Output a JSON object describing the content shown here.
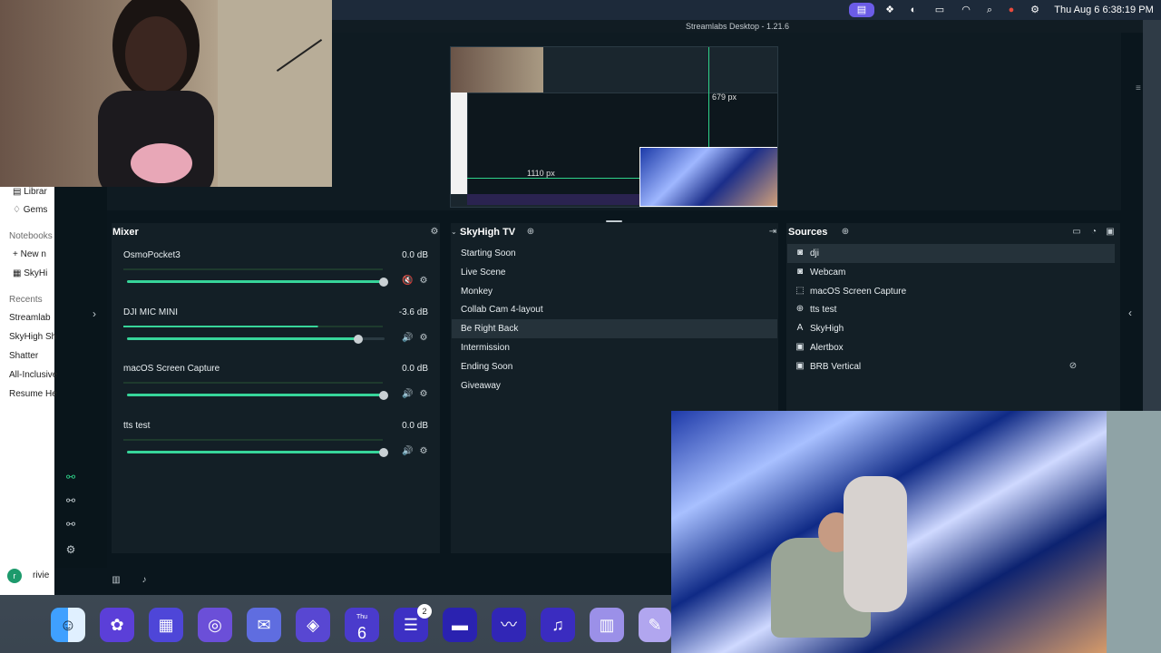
{
  "menubar": {
    "date_time": "Thu Aug 6  6:38:19 PM",
    "icons": [
      "stage-manager-icon",
      "app-icon",
      "circle-icon",
      "battery-icon",
      "wifi-icon",
      "search-icon",
      "chrome-icon",
      "control-center-icon",
      "siri-icon"
    ]
  },
  "window": {
    "title": "Streamlabs Desktop - 1.21.6"
  },
  "notebook_panel": {
    "items_top": [
      {
        "icon": "library-icon",
        "label": "Librar"
      },
      {
        "icon": "gems-icon",
        "label": "Gems"
      }
    ],
    "notebooks_label": "Notebooks",
    "notebook_items": [
      {
        "icon": "plus-icon",
        "label": "New n"
      },
      {
        "icon": "notebook-icon",
        "label": "SkyHi"
      }
    ],
    "recents_label": "Recents",
    "recents": [
      "Streamlab",
      "SkyHigh Sh",
      "Shatter",
      "All-Inclusive",
      "Resume He"
    ],
    "user_label": "rivie"
  },
  "preview": {
    "width_label": "1110 px",
    "height_label": "679 px"
  },
  "mixer": {
    "title": "Mixer",
    "items": [
      {
        "name": "OsmoPocket3",
        "db": "0.0 dB",
        "level": 1.0,
        "muted": true
      },
      {
        "name": "DJI MIC MINI",
        "db": "-3.6 dB",
        "level": 0.9,
        "muted": false
      },
      {
        "name": "macOS Screen Capture",
        "db": "0.0 dB",
        "level": 1.0,
        "muted": false
      },
      {
        "name": "tts test",
        "db": "0.0 dB",
        "level": 1.0,
        "muted": false
      }
    ]
  },
  "scenes": {
    "title": "SkyHigh TV",
    "items": [
      "Starting Soon",
      "Live Scene",
      "Monkey",
      "Collab Cam 4-layout",
      "Be Right Back",
      "Intermission",
      "Ending Soon",
      "Giveaway"
    ],
    "selected": "Be Right Back"
  },
  "sources": {
    "title": "Sources",
    "items": [
      {
        "icon": "camera-icon",
        "label": "dji"
      },
      {
        "icon": "camera-icon",
        "label": "Webcam"
      },
      {
        "icon": "screen-capture-icon",
        "label": "macOS Screen Capture"
      },
      {
        "icon": "globe-icon",
        "label": "tts test"
      },
      {
        "icon": "text-icon",
        "label": "SkyHigh"
      },
      {
        "icon": "image-icon",
        "label": "Alertbox"
      },
      {
        "icon": "image-icon",
        "label": "BRB Vertical"
      }
    ],
    "selected": "dji"
  },
  "dock": {
    "calendar_month": "Thu",
    "calendar_day": "6",
    "badge": "2",
    "apps": [
      "finder-icon",
      "photos-icon",
      "launchpad-icon",
      "chrome-icon",
      "mail-icon",
      "safari-icon",
      "calendar-icon",
      "reminders-icon",
      "notes-icon",
      "freeform-icon",
      "music-icon",
      "numbers-icon",
      "pages-icon"
    ]
  },
  "colors": {
    "accent": "#37d59a",
    "panel_bg": "#131f26",
    "window_bg": "#0a161d"
  }
}
